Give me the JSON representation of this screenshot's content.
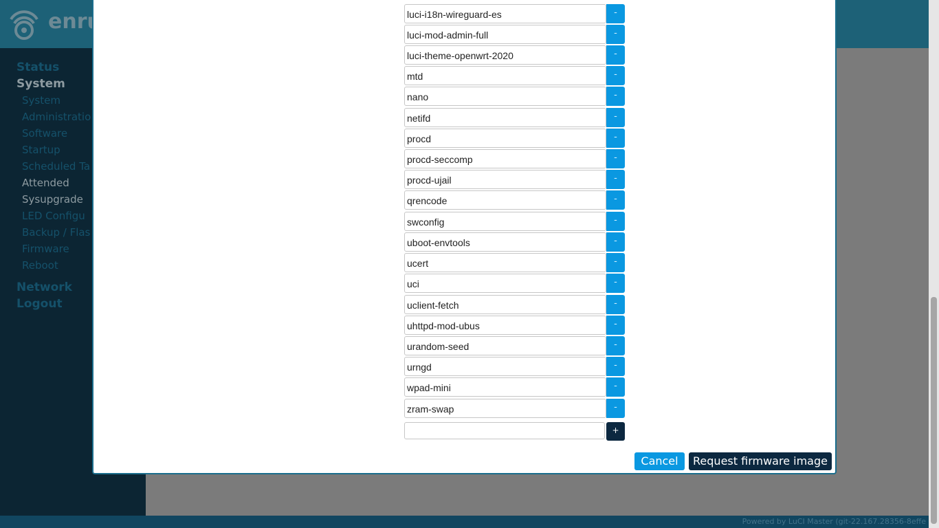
{
  "header": {
    "brand": "enru"
  },
  "sidebar": {
    "status": "Status",
    "system": "System",
    "sub": [
      "System",
      "Administratio",
      "Software",
      "Startup",
      "Scheduled Ta",
      "Attended",
      "Sysupgrade",
      "LED Configu",
      "Backup / Flas",
      "Firmware",
      "Reboot"
    ],
    "network": "Network",
    "logout": "Logout"
  },
  "footer": {
    "text": "Powered by LuCI Master (git-22.167.28356-8effe"
  },
  "modal": {
    "packages": [
      "luci-i18n-wireguard-es",
      "luci-mod-admin-full",
      "luci-theme-openwrt-2020",
      "mtd",
      "nano",
      "netifd",
      "procd",
      "procd-seccomp",
      "procd-ujail",
      "qrencode",
      "swconfig",
      "uboot-envtools",
      "ucert",
      "uci",
      "uclient-fetch",
      "uhttpd-mod-ubus",
      "urandom-seed",
      "urngd",
      "wpad-mini",
      "zram-swap"
    ],
    "remove_label": "-",
    "add_label": "+",
    "new_package_value": "",
    "cancel": "Cancel",
    "request": "Request firmware image"
  },
  "colors": {
    "header": "#1d6177",
    "sidebar": "#0c2533",
    "accent": "#0a98e1",
    "dark_button": "#0c2840"
  }
}
